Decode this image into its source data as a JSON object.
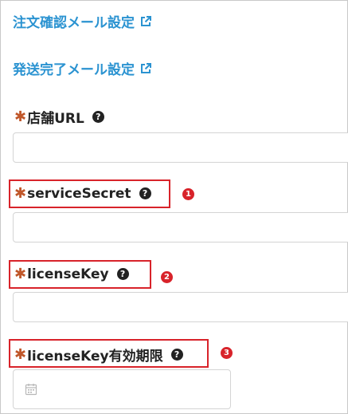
{
  "links": {
    "order_confirm": "注文確認メール設定",
    "shipping_complete": "発送完了メール設定"
  },
  "fields": {
    "shop_url": {
      "required": "✱",
      "label": "店舗URL",
      "help": "?"
    },
    "service_secret": {
      "required": "✱",
      "label": "serviceSecret",
      "help": "?"
    },
    "license_key": {
      "required": "✱",
      "label": "licenseKey",
      "help": "?"
    },
    "license_expiry": {
      "required": "✱",
      "label": "licenseKey有効期限",
      "help": "?"
    }
  },
  "callouts": [
    "1",
    "2",
    "3"
  ],
  "colors": {
    "link": "#2b93d1",
    "required": "#c0572a",
    "callout": "#d8232a"
  },
  "icons": [
    "external-link-icon",
    "help-icon",
    "calendar-icon"
  ]
}
